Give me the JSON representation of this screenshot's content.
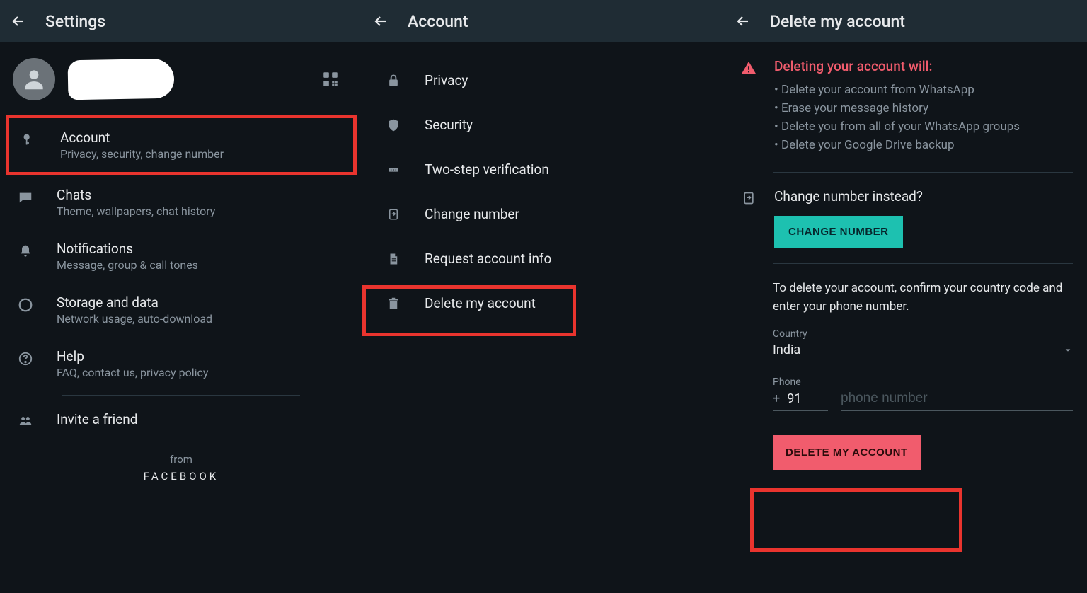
{
  "pane1": {
    "title": "Settings",
    "items": [
      {
        "title": "Account",
        "desc": "Privacy, security, change number"
      },
      {
        "title": "Chats",
        "desc": "Theme, wallpapers, chat history"
      },
      {
        "title": "Notifications",
        "desc": "Message, group & call tones"
      },
      {
        "title": "Storage and data",
        "desc": "Network usage, auto-download"
      },
      {
        "title": "Help",
        "desc": "FAQ, contact us, privacy policy"
      }
    ],
    "invite": "Invite a friend",
    "from": "from",
    "facebook": "FACEBOOK"
  },
  "pane2": {
    "title": "Account",
    "items": [
      "Privacy",
      "Security",
      "Two-step verification",
      "Change number",
      "Request account info",
      "Delete my account"
    ]
  },
  "pane3": {
    "title": "Delete my account",
    "warningTitle": "Deleting your account will:",
    "warningItems": [
      "Delete your account from WhatsApp",
      "Erase your message history",
      "Delete you from all of your WhatsApp groups",
      "Delete your Google Drive backup"
    ],
    "changeTitle": "Change number instead?",
    "changeBtn": "CHANGE NUMBER",
    "confirmText": "To delete your account, confirm your country code and enter your phone number.",
    "countryLabel": "Country",
    "countryValue": "India",
    "phoneLabel": "Phone",
    "plus": "+",
    "cc": "91",
    "phonePlaceholder": "phone number",
    "deleteBtn": "DELETE MY ACCOUNT"
  }
}
